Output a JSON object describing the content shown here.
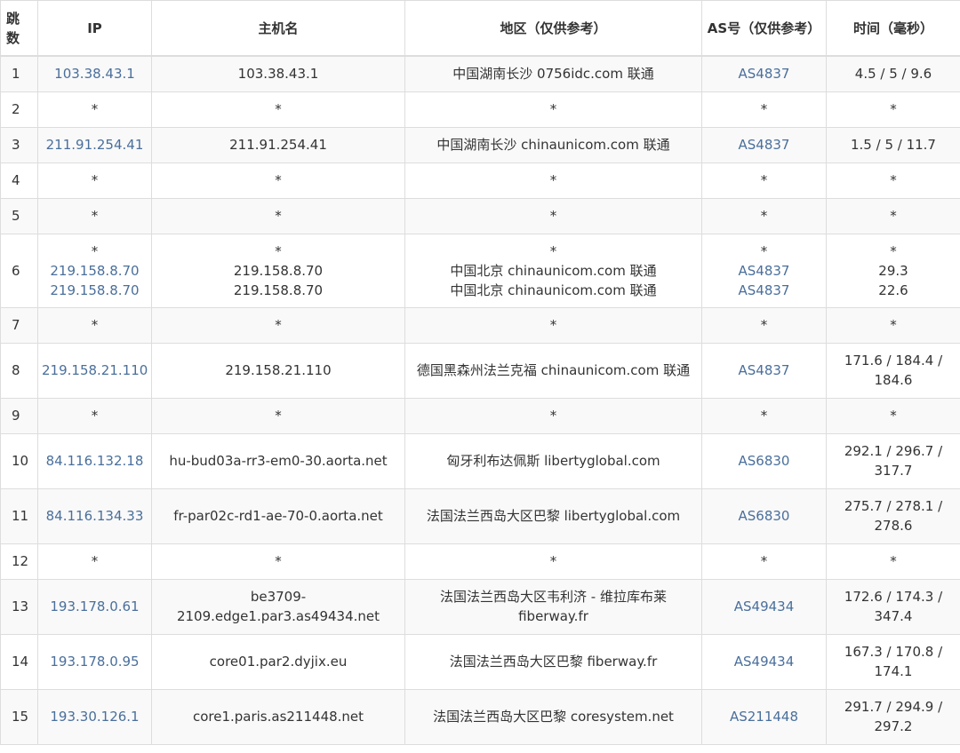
{
  "headers": {
    "hop": "跳数",
    "ip": "IP",
    "host": "主机名",
    "region": "地区（仅供参考）",
    "as": "AS号（仅供参考）",
    "time": "时间（毫秒）"
  },
  "rows": [
    {
      "hop": "1",
      "ip": [
        "103.38.43.1"
      ],
      "host": [
        "103.38.43.1"
      ],
      "region": [
        "中国湖南长沙 0756idc.com 联通"
      ],
      "as": [
        "AS4837"
      ],
      "time": [
        "4.5 / 5 / 9.6"
      ]
    },
    {
      "hop": "2",
      "ip": [
        "*"
      ],
      "host": [
        "*"
      ],
      "region": [
        "*"
      ],
      "as": [
        "*"
      ],
      "time": [
        "*"
      ]
    },
    {
      "hop": "3",
      "ip": [
        "211.91.254.41"
      ],
      "host": [
        "211.91.254.41"
      ],
      "region": [
        "中国湖南长沙 chinaunicom.com 联通"
      ],
      "as": [
        "AS4837"
      ],
      "time": [
        "1.5 / 5 / 11.7"
      ]
    },
    {
      "hop": "4",
      "ip": [
        "*"
      ],
      "host": [
        "*"
      ],
      "region": [
        "*"
      ],
      "as": [
        "*"
      ],
      "time": [
        "*"
      ]
    },
    {
      "hop": "5",
      "ip": [
        "*"
      ],
      "host": [
        "*"
      ],
      "region": [
        "*"
      ],
      "as": [
        "*"
      ],
      "time": [
        "*"
      ]
    },
    {
      "hop": "6",
      "ip": [
        "*",
        "219.158.8.70",
        "219.158.8.70"
      ],
      "host": [
        "*",
        "219.158.8.70",
        "219.158.8.70"
      ],
      "region": [
        "*",
        "中国北京 chinaunicom.com 联通",
        "中国北京 chinaunicom.com 联通"
      ],
      "as": [
        "*",
        "AS4837",
        "AS4837"
      ],
      "time": [
        "*",
        "29.3",
        "22.6"
      ]
    },
    {
      "hop": "7",
      "ip": [
        "*"
      ],
      "host": [
        "*"
      ],
      "region": [
        "*"
      ],
      "as": [
        "*"
      ],
      "time": [
        "*"
      ]
    },
    {
      "hop": "8",
      "ip": [
        "219.158.21.110"
      ],
      "host": [
        "219.158.21.110"
      ],
      "region": [
        "德国黑森州法兰克福 chinaunicom.com 联通"
      ],
      "as": [
        "AS4837"
      ],
      "time": [
        "171.6 / 184.4 /",
        "184.6"
      ]
    },
    {
      "hop": "9",
      "ip": [
        "*"
      ],
      "host": [
        "*"
      ],
      "region": [
        "*"
      ],
      "as": [
        "*"
      ],
      "time": [
        "*"
      ]
    },
    {
      "hop": "10",
      "ip": [
        "84.116.132.18"
      ],
      "host": [
        "hu-bud03a-rr3-em0-30.aorta.net"
      ],
      "region": [
        "匈牙利布达佩斯 libertyglobal.com"
      ],
      "as": [
        "AS6830"
      ],
      "time": [
        "292.1 / 296.7 /",
        "317.7"
      ]
    },
    {
      "hop": "11",
      "ip": [
        "84.116.134.33"
      ],
      "host": [
        "fr-par02c-rd1-ae-70-0.aorta.net"
      ],
      "region": [
        "法国法兰西岛大区巴黎 libertyglobal.com"
      ],
      "as": [
        "AS6830"
      ],
      "time": [
        "275.7 / 278.1 /",
        "278.6"
      ]
    },
    {
      "hop": "12",
      "ip": [
        "*"
      ],
      "host": [
        "*"
      ],
      "region": [
        "*"
      ],
      "as": [
        "*"
      ],
      "time": [
        "*"
      ]
    },
    {
      "hop": "13",
      "ip": [
        "193.178.0.61"
      ],
      "host": [
        "be3709-",
        "2109.edge1.par3.as49434.net"
      ],
      "region": [
        "法国法兰西岛大区韦利济 - 维拉库布莱",
        "fiberway.fr"
      ],
      "as": [
        "AS49434"
      ],
      "time": [
        "172.6 / 174.3 /",
        "347.4"
      ]
    },
    {
      "hop": "14",
      "ip": [
        "193.178.0.95"
      ],
      "host": [
        "core01.par2.dyjix.eu"
      ],
      "region": [
        "法国法兰西岛大区巴黎 fiberway.fr"
      ],
      "as": [
        "AS49434"
      ],
      "time": [
        "167.3 / 170.8 /",
        "174.1"
      ]
    },
    {
      "hop": "15",
      "ip": [
        "193.30.126.1"
      ],
      "host": [
        "core1.paris.as211448.net"
      ],
      "region": [
        "法国法兰西岛大区巴黎 coresystem.net"
      ],
      "as": [
        "AS211448"
      ],
      "time": [
        "291.7 / 294.9 /",
        "297.2"
      ]
    }
  ]
}
